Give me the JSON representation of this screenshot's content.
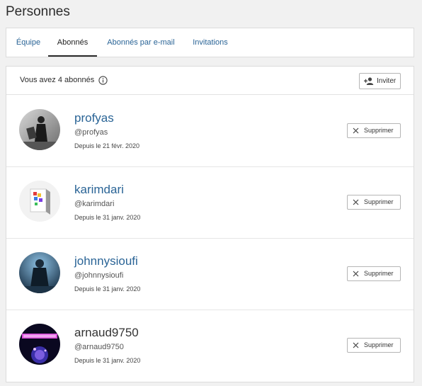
{
  "page": {
    "title": "Personnes"
  },
  "tabs": [
    {
      "label": "Équipe",
      "active": false
    },
    {
      "label": "Abonnés",
      "active": true
    },
    {
      "label": "Abonnés par e-mail",
      "active": false
    },
    {
      "label": "Invitations",
      "active": false
    }
  ],
  "header": {
    "count_text": "Vous avez 4 abonnés",
    "info_icon": "info-circle-icon",
    "invite_label": "Inviter",
    "invite_icon": "add-user-icon"
  },
  "remove_icon": "close-x-icon",
  "subscribers": [
    {
      "name": "profyas",
      "handle": "@profyas",
      "since": "Depuis le 21 févr. 2020",
      "remove_label": "Supprimer"
    },
    {
      "name": "karimdari",
      "handle": "@karimdari",
      "since": "Depuis le 31 janv. 2020",
      "remove_label": "Supprimer"
    },
    {
      "name": "johnnysioufi",
      "handle": "@johnnysioufi",
      "since": "Depuis le 31 janv. 2020",
      "remove_label": "Supprimer"
    },
    {
      "name": "arnaud9750",
      "handle": "@arnaud9750",
      "since": "Depuis le 31 janv. 2020",
      "remove_label": "Supprimer"
    }
  ],
  "colors": {
    "link": "#2a6496",
    "active_tab_underline": "#2a2a2a"
  }
}
